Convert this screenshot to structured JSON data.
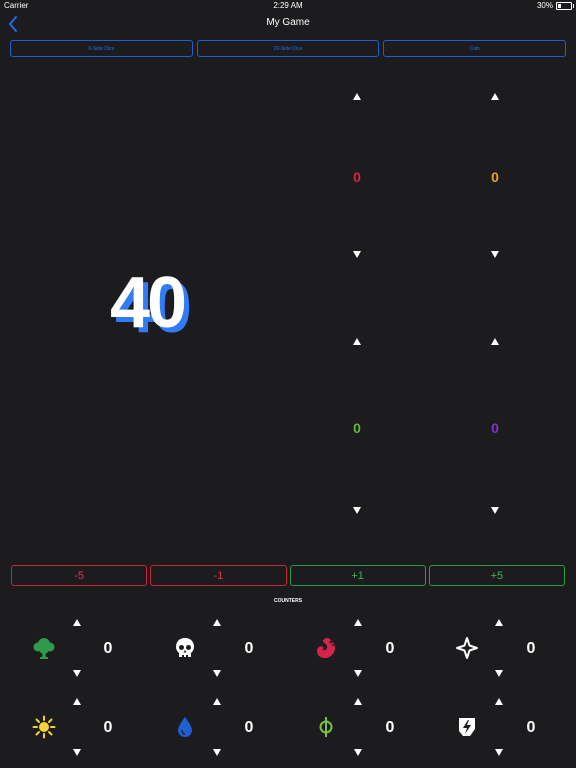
{
  "status": {
    "carrier": "Carrier",
    "time": "2:29 AM",
    "battery": "30%"
  },
  "nav": {
    "title": "My Game"
  },
  "dice": [
    "6-Side Dice",
    "20-Side Dice",
    "Coin"
  ],
  "life": {
    "total": "40"
  },
  "commander_damage": [
    {
      "value": "0",
      "color": "#d6254a"
    },
    {
      "value": "0",
      "color": "#f0a020"
    },
    {
      "value": "0",
      "color": "#5fb83a"
    },
    {
      "value": "0",
      "color": "#8a2ed0"
    }
  ],
  "adjust": [
    "-5",
    "-1",
    "+1",
    "+5"
  ],
  "counters_label": "COUNTERS",
  "counters": [
    {
      "icon": "tree-icon",
      "value": "0",
      "color": "#2f9a4a"
    },
    {
      "icon": "skull-icon",
      "value": "0",
      "color": "#ffffff"
    },
    {
      "icon": "fire-icon",
      "value": "0",
      "color": "#d6254a"
    },
    {
      "icon": "sparkle-icon",
      "value": "0",
      "color": "#ffffff"
    },
    {
      "icon": "sun-icon",
      "value": "0",
      "color": "#f2d33a"
    },
    {
      "icon": "water-drop-icon",
      "value": "0",
      "color": "#1e5fd1"
    },
    {
      "icon": "phi-icon",
      "value": "0",
      "color": "#7bc043"
    },
    {
      "icon": "energy-icon",
      "value": "0",
      "color": "#ffffff"
    }
  ]
}
